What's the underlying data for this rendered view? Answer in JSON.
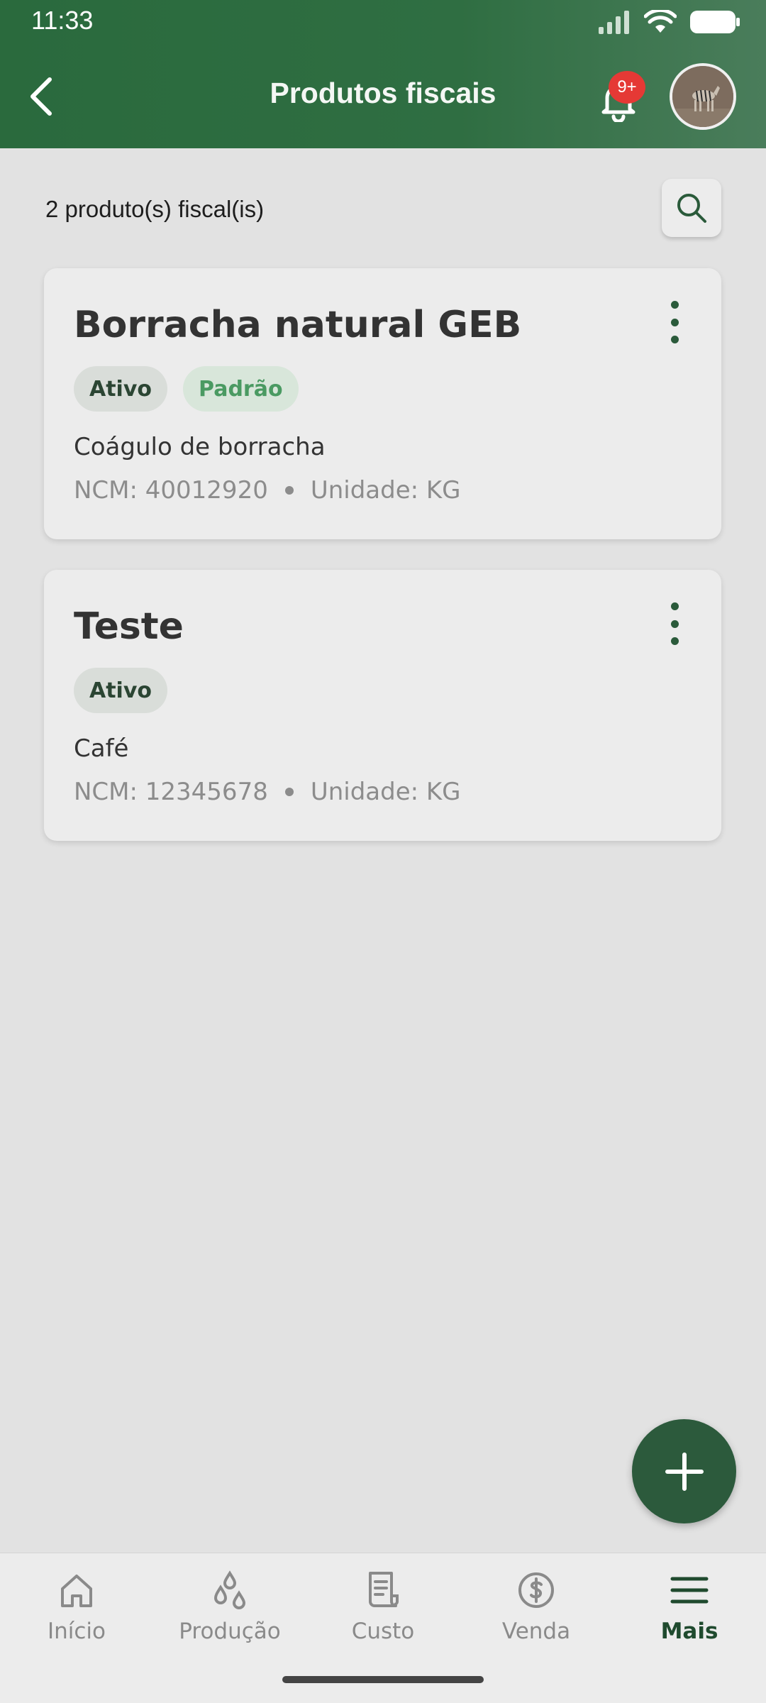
{
  "status_bar": {
    "time": "11:33"
  },
  "header": {
    "title": "Produtos fiscais",
    "notification_badge": "9+"
  },
  "list": {
    "count_text": "2 produto(s) fiscal(is)",
    "items": [
      {
        "title": "Borracha natural GEB",
        "chips": [
          "Ativo",
          "Padrão"
        ],
        "description": "Coágulo de borracha",
        "ncm": "NCM: 40012920",
        "unit": "Unidade: KG"
      },
      {
        "title": "Teste",
        "chips": [
          "Ativo"
        ],
        "description": "Café",
        "ncm": "NCM: 12345678",
        "unit": "Unidade: KG"
      }
    ]
  },
  "bottom_nav": {
    "items": [
      {
        "label": "Início",
        "icon": "home-icon"
      },
      {
        "label": "Produção",
        "icon": "drops-icon"
      },
      {
        "label": "Custo",
        "icon": "receipt-icon"
      },
      {
        "label": "Venda",
        "icon": "dollar-icon"
      },
      {
        "label": "Mais",
        "icon": "menu-icon",
        "active": true
      }
    ]
  },
  "colors": {
    "header": "#2f6e42",
    "accent": "#2c5a3c",
    "badge": "#e53935",
    "background": "#e2e2e2",
    "card": "#ececec"
  }
}
